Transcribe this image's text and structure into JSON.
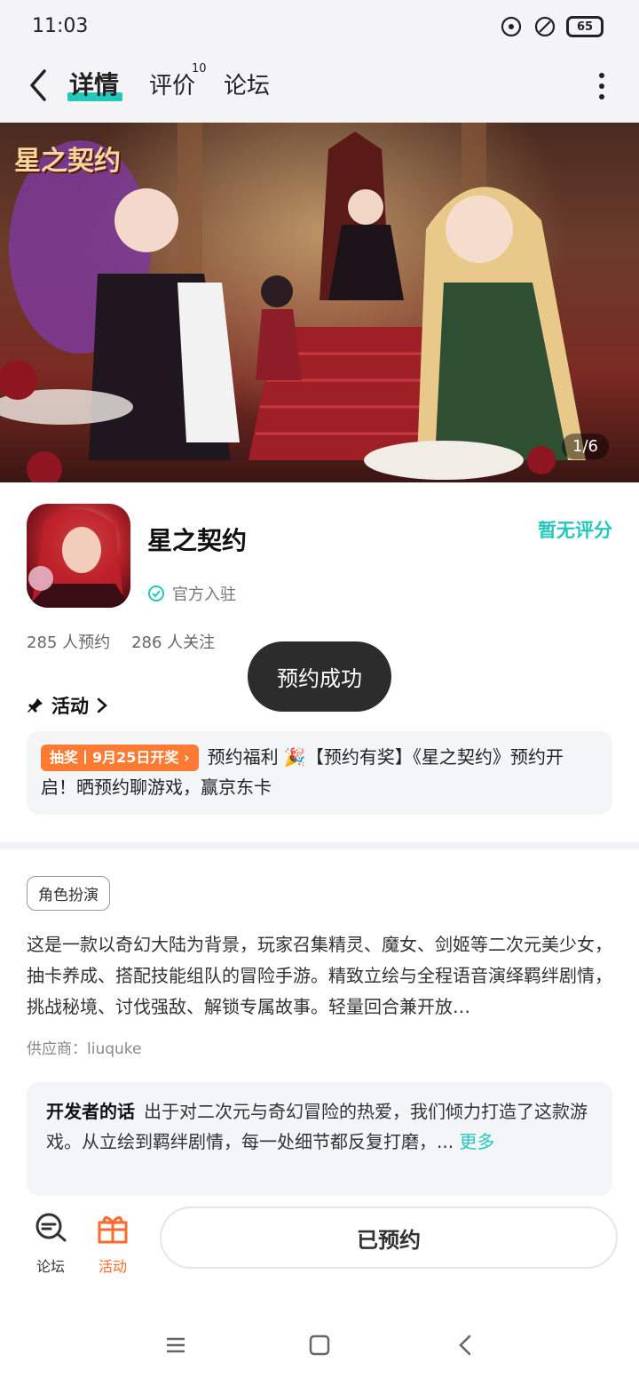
{
  "status_bar": {
    "time": "11:03",
    "battery": "65"
  },
  "nav": {
    "tabs": [
      {
        "label": "详情"
      },
      {
        "label": "评价",
        "badge": "10"
      },
      {
        "label": "论坛"
      }
    ]
  },
  "banner": {
    "logo_text": "星之契约",
    "counter": "1/6"
  },
  "app": {
    "name": "星之契约",
    "verified_label": "官方入驻",
    "rating": "暂无评分",
    "reservations": "285 人预约",
    "followers": "286 人关注"
  },
  "activity": {
    "section_label": "活动",
    "tag": "抽奖丨9月25日开奖",
    "text": "预约福利 🎉【预约有奖】《星之契约》预约开启！晒预约聊游戏，赢京东卡"
  },
  "toast": "预约成功",
  "details": {
    "genre_tag": "角色扮演",
    "description": "这是一款以奇幻大陆为背景，玩家召集精灵、魔女、剑姬等二次元美少女，抽卡养成、搭配技能组队的冒险手游。精致立绘与全程语音演绎羁绊剧情，挑战秘境、讨伐强敌、解锁专属故事。轻量回合兼开放…",
    "supplier": "供应商：liuquke",
    "developer_title": "开发者的话",
    "developer_text": "出于对二次元与奇幻冒险的热爱，我们倾力打造了这款游戏。从立绘到羁绊剧情，每一处细节都反复打磨，...",
    "developer_more": "更多"
  },
  "bottom_bar": {
    "forum_label": "论坛",
    "activity_label": "活动",
    "reserved_label": "已预约"
  },
  "colors": {
    "accent": "#23c8bb",
    "orange": "#ff7a32",
    "toast_bg": "#2c2c2c"
  }
}
